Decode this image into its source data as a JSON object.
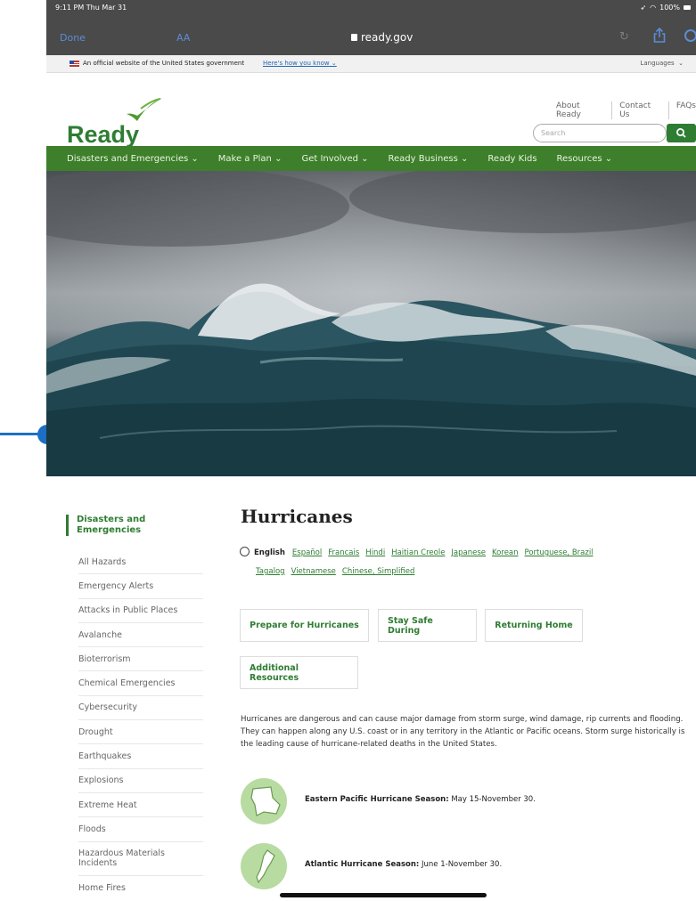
{
  "status": {
    "time": "9:11 PM  Thu Mar 31",
    "battery": "100%"
  },
  "safari": {
    "done": "Done",
    "aa": "AA",
    "url": "ready.gov"
  },
  "gov_banner": {
    "official": "An official website of the United States government",
    "how_know": "Here's how you know",
    "languages": "Languages"
  },
  "header": {
    "logo": "Ready",
    "links": [
      "About Ready",
      "Contact Us",
      "FAQs"
    ],
    "search_placeholder": "Search"
  },
  "nav": [
    "Disasters and Emergencies ⌄",
    "Make a Plan ⌄",
    "Get Involved ⌄",
    "Ready Business ⌄",
    "Ready Kids",
    "Resources ⌄"
  ],
  "sidebar": {
    "heading": "Disasters and Emergencies",
    "items": [
      "All Hazards",
      "Emergency Alerts",
      "Attacks in Public Places",
      "Avalanche",
      "Bioterrorism",
      "Chemical Emergencies",
      "Cybersecurity",
      "Drought",
      "Earthquakes",
      "Explosions",
      "Extreme Heat",
      "Floods",
      "Hazardous Materials Incidents",
      "Home Fires"
    ]
  },
  "main": {
    "title": "Hurricanes",
    "current_language": "English",
    "languages": [
      "Español",
      "Francais",
      "Hindi",
      "Haitian Creole",
      "Japanese",
      "Korean",
      "Portuguese, Brazil",
      "Tagalog",
      "Vietnamese",
      "Chinese, Simplified"
    ],
    "tabs": [
      "Prepare for Hurricanes",
      "Stay Safe During",
      "Returning Home",
      "Additional Resources"
    ],
    "paragraph": "Hurricanes are dangerous and can cause major damage from storm surge, wind damage, rip currents and flooding. They can happen along any U.S. coast or in any territory in the Atlantic or Pacific oceans. Storm surge historically is the leading cause of hurricane-related deaths in the United States.",
    "seasons": [
      {
        "label": "Eastern Pacific Hurricane Season:",
        "dates": "May 15-November 30."
      },
      {
        "label": "Atlantic Hurricane Season:",
        "dates": "June 1-November 30."
      }
    ]
  },
  "colors": {
    "brand_green": "#2e7d32",
    "nav_green": "#3d7f2a",
    "marker_blue": "#1c6fc4"
  }
}
